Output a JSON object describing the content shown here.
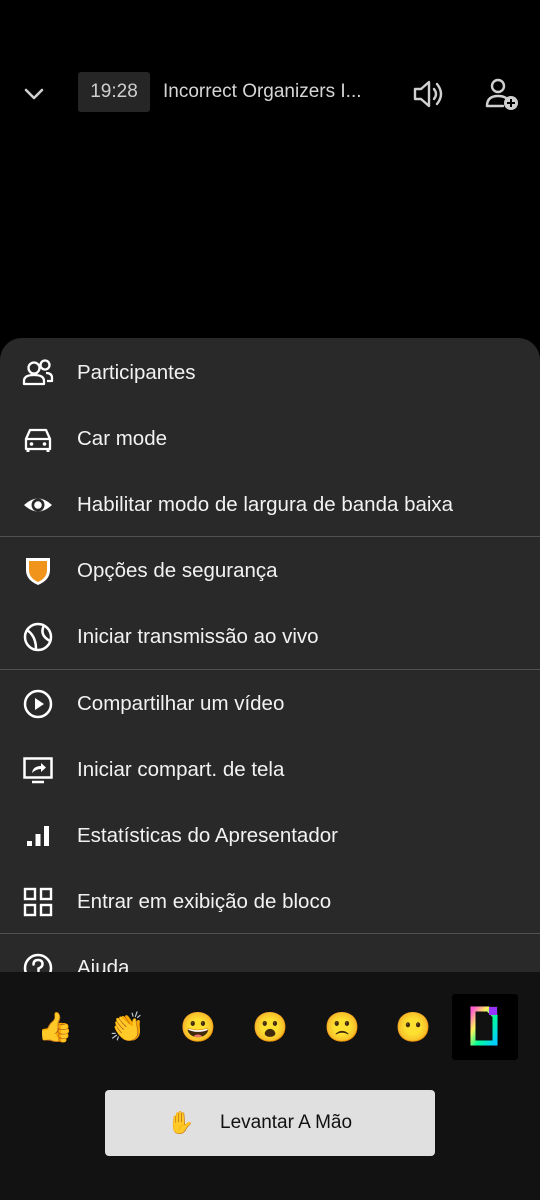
{
  "header": {
    "time": "19:28",
    "meeting_title": "Incorrect Organizers I...",
    "icons": [
      "chevron-down-icon",
      "speaker-icon",
      "add-participant-icon"
    ]
  },
  "menu": {
    "items": [
      {
        "label": "Participantes",
        "icon": "participants-icon"
      },
      {
        "label": "Car mode",
        "icon": "car-icon"
      },
      {
        "label": "Habilitar modo de largura de banda baixa",
        "icon": "eye-icon"
      },
      {
        "label": "Opções de segurança",
        "icon": "shield-icon"
      },
      {
        "label": "Iniciar transmissão ao vivo",
        "icon": "globe-icon"
      },
      {
        "label": "Compartilhar um vídeo",
        "icon": "play-circle-icon"
      },
      {
        "label": "Iniciar compart. de tela",
        "icon": "screen-share-icon"
      },
      {
        "label": "Estatísticas do Apresentador",
        "icon": "stats-icon"
      },
      {
        "label": "Entrar em exibição de bloco",
        "icon": "tile-view-icon"
      },
      {
        "label": "Ajuda",
        "icon": "help-icon"
      }
    ]
  },
  "reactions": {
    "emojis": [
      "👍",
      "👏",
      "😀",
      "😮",
      "🙁",
      "😶"
    ],
    "gif_icon": "gif-icon"
  },
  "raise_hand": {
    "emoji": "✋",
    "label": "Levantar A Mão"
  },
  "colors": {
    "sheet": "#292929",
    "bottom": "#121212",
    "shield": "#f0941c",
    "button": "#e0e0e0"
  }
}
